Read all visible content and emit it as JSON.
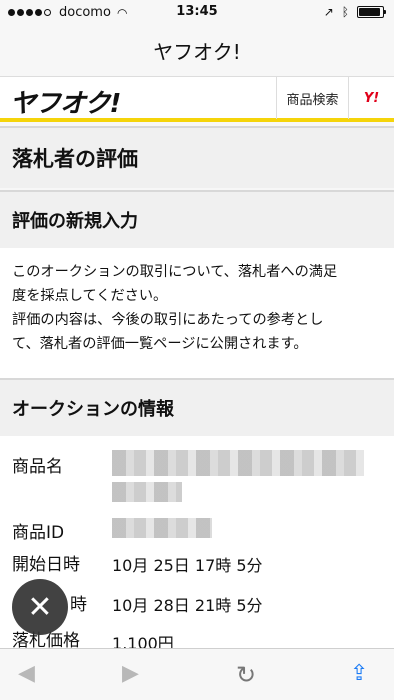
{
  "status_bar": {
    "carrier": "docomo",
    "time": "13:45",
    "battery_level": 0.9,
    "icons": [
      "signal-dots-icon",
      "wifi-icon",
      "location-arrow-icon",
      "bluetooth-icon",
      "battery-icon"
    ]
  },
  "browser": {
    "page_title": "ヤフオク!"
  },
  "header": {
    "logo_text": "ヤフオク!",
    "search_label": "商品検索",
    "yahoo_label": "Y!"
  },
  "main": {
    "page_heading": "落札者の評価",
    "new_rating": {
      "heading": "評価の新規入力",
      "description_line1": "このオークションの取引について、落札者への満足",
      "description_line2": "度を採点してください。",
      "description_line3": "評価の内容は、今後の取引にあたっての参考とし",
      "description_line4": "て、落札者の評価一覧ページに公開されます。"
    },
    "auction_info": {
      "heading": "オークションの情報",
      "item_name_label": "商品名",
      "item_id_label": "商品ID",
      "start_label": "開始日時",
      "start_value": "10月 25日 17時 5分",
      "end_label": "時",
      "end_value": "10月 28日 21時 5分",
      "price_label": "落札価格",
      "price_value": "1,100円"
    }
  },
  "colors": {
    "accent_yellow": "#f5d40a",
    "yahoo_red": "#e0001a",
    "ios_blue": "#1b7bf5"
  }
}
